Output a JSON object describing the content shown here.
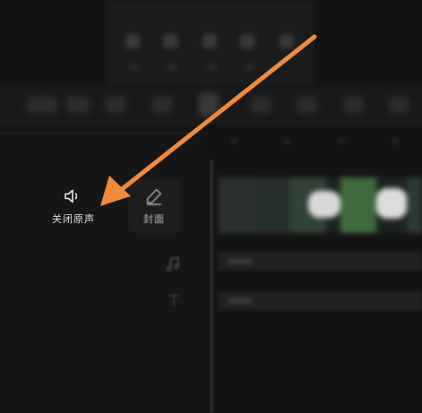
{
  "tools": {
    "mute": {
      "label": "关闭原声",
      "icon": "speaker-icon"
    },
    "cover": {
      "label": "封面",
      "icon": "pencil-icon"
    },
    "music": {
      "icon": "music-note-icon"
    },
    "text": {
      "icon": "text-icon"
    }
  },
  "colors": {
    "background": "#161616",
    "annotation_arrow": "#f08a3c",
    "label_text": "#e2e2e2"
  }
}
